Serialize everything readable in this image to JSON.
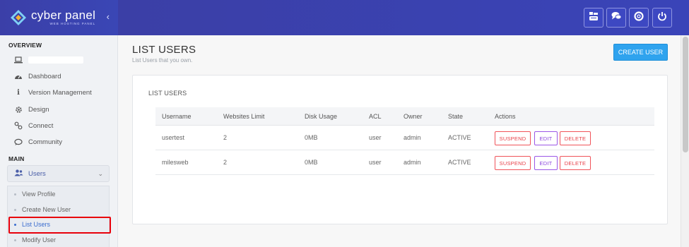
{
  "brand": {
    "title": "cyber panel",
    "subtitle": "WEB HOSTING PANEL",
    "collapse_glyph": "‹"
  },
  "sidebar": {
    "overview_label": "OVERVIEW",
    "main_label": "MAIN",
    "items": [
      {
        "icon": "laptop-icon",
        "label": ""
      },
      {
        "icon": "tachometer-icon",
        "label": "Dashboard"
      },
      {
        "icon": "info-icon",
        "label": "Version Management"
      },
      {
        "icon": "gear-icon",
        "label": "Design"
      },
      {
        "icon": "link-icon",
        "label": "Connect"
      },
      {
        "icon": "comment-icon",
        "label": "Community"
      }
    ],
    "users_menu": {
      "icon": "users-icon",
      "label": "Users",
      "chevron": "⌄"
    },
    "submenu": [
      {
        "label": "View Profile",
        "active": false
      },
      {
        "label": "Create New User",
        "active": false
      },
      {
        "label": "List Users",
        "active": true
      },
      {
        "label": "Modify User",
        "active": false
      }
    ]
  },
  "header": {
    "buttons": [
      {
        "icon": "youtube-icon"
      },
      {
        "icon": "chat-icon"
      },
      {
        "icon": "support-icon"
      },
      {
        "icon": "power-icon"
      }
    ]
  },
  "main": {
    "title": "LIST USERS",
    "subtitle": "List Users that you own.",
    "create_button": "CREATE USER",
    "panel_title": "LIST USERS",
    "table": {
      "headers": [
        "Username",
        "Websites Limit",
        "Disk Usage",
        "ACL",
        "Owner",
        "State",
        "Actions"
      ],
      "rows": [
        {
          "username": "usertest",
          "websites_limit": "2",
          "disk_usage": "0MB",
          "acl": "user",
          "owner": "admin",
          "state": "ACTIVE"
        },
        {
          "username": "milesweb",
          "websites_limit": "2",
          "disk_usage": "0MB",
          "acl": "user",
          "owner": "admin",
          "state": "ACTIVE"
        }
      ],
      "actions": {
        "suspend": "SUSPEND",
        "edit": "EDIT",
        "delete": "DELETE"
      }
    }
  },
  "colors": {
    "header_bg": "#3a43b5",
    "primary_button": "#2fa3ee",
    "danger": "#e8424a",
    "edit": "#8b45dd",
    "active_link": "#3a6ccf",
    "highlight_box": "#e8000b"
  }
}
